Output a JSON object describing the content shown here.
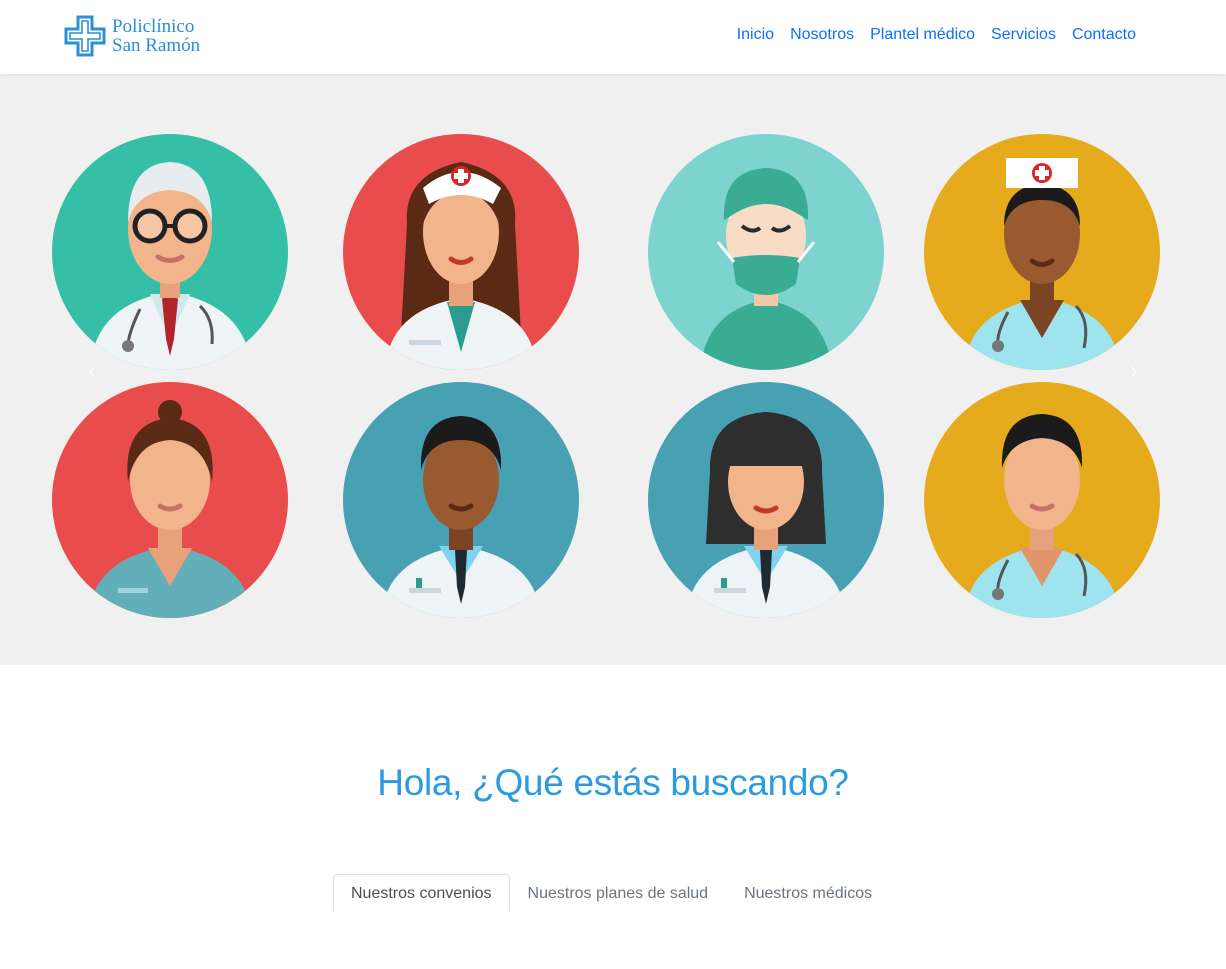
{
  "brand": {
    "line1": "Policlínico",
    "line2": "San Ramón",
    "logo": "medical-cross-logo"
  },
  "nav": {
    "items": [
      {
        "label": "Inicio"
      },
      {
        "label": "Nosotros"
      },
      {
        "label": "Plantel médico"
      },
      {
        "label": "Servicios"
      },
      {
        "label": "Contacto"
      }
    ]
  },
  "carousel": {
    "prev_label": "‹",
    "next_label": "›",
    "avatars": [
      {
        "name": "doctor-elder-glasses",
        "bg": "#35bfa6"
      },
      {
        "name": "nurse-cap-long-hair",
        "bg": "#e94c4c"
      },
      {
        "name": "surgeon-mask",
        "bg": "#7dd3cf"
      },
      {
        "name": "nurse-cap-dark-skin",
        "bg": "#e5ab1d"
      },
      {
        "name": "nurse-scrubs",
        "bg": "#e94c4c"
      },
      {
        "name": "doctor-dark-skin",
        "bg": "#48a0b3"
      },
      {
        "name": "doctor-woman-bangs",
        "bg": "#48a0b3"
      },
      {
        "name": "nurse-man-stethoscope",
        "bg": "#e5ab1d"
      }
    ]
  },
  "headline": "Hola, ¿Qué estás buscando?",
  "tabs": [
    {
      "label": "Nuestros convenios",
      "active": true
    },
    {
      "label": "Nuestros planes de salud",
      "active": false
    },
    {
      "label": "Nuestros médicos",
      "active": false
    }
  ],
  "colors": {
    "accent": "#2a9be0",
    "link": "#0d6efd",
    "carousel_bg": "#f0f0f0"
  }
}
